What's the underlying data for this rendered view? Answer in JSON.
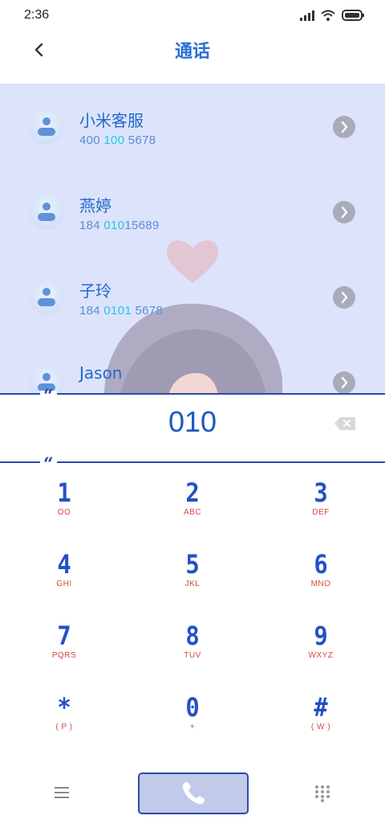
{
  "status_bar": {
    "time": "2:36",
    "icons": [
      "signal-icon",
      "wifi-icon",
      "battery-icon"
    ]
  },
  "header": {
    "title": "通话",
    "back_icon": "back-arrow-icon"
  },
  "contacts": [
    {
      "name": "小米客服",
      "number_parts": [
        "400",
        " 100",
        " 5678"
      ]
    },
    {
      "name": "燕婷",
      "number_parts": [
        "184 ",
        "010",
        "15689"
      ]
    },
    {
      "name": "子玲",
      "number_parts": [
        "184 ",
        "0101",
        " 5678"
      ]
    },
    {
      "name": "Jason",
      "number_parts": [
        "",
        "",
        ""
      ]
    }
  ],
  "dial": {
    "input": "010",
    "backspace_icon": "backspace-icon",
    "quote_mark": "“"
  },
  "keys": [
    {
      "digit": "1",
      "letters": "OO"
    },
    {
      "digit": "2",
      "letters": "ABC"
    },
    {
      "digit": "3",
      "letters": "DEF"
    },
    {
      "digit": "4",
      "letters": "GHI"
    },
    {
      "digit": "5",
      "letters": "JKL"
    },
    {
      "digit": "6",
      "letters": "MNO"
    },
    {
      "digit": "7",
      "letters": "PQRS"
    },
    {
      "digit": "8",
      "letters": "TUV"
    },
    {
      "digit": "9",
      "letters": "WXYZ"
    },
    {
      "digit": "*",
      "letters": "( P )"
    },
    {
      "digit": "0",
      "letters": "+"
    },
    {
      "digit": "#",
      "letters": "( W )"
    }
  ],
  "bottom_bar": {
    "menu_icon": "menu-icon",
    "call_icon": "phone-icon",
    "dialpad_icon": "dialpad-icon"
  },
  "colors": {
    "accent": "#2d49a8",
    "title_blue": "#2a6fd6",
    "highlight_cyan": "#1cc8e8",
    "key_letters_red": "#d44a3a",
    "list_background": "#dde3fb"
  }
}
